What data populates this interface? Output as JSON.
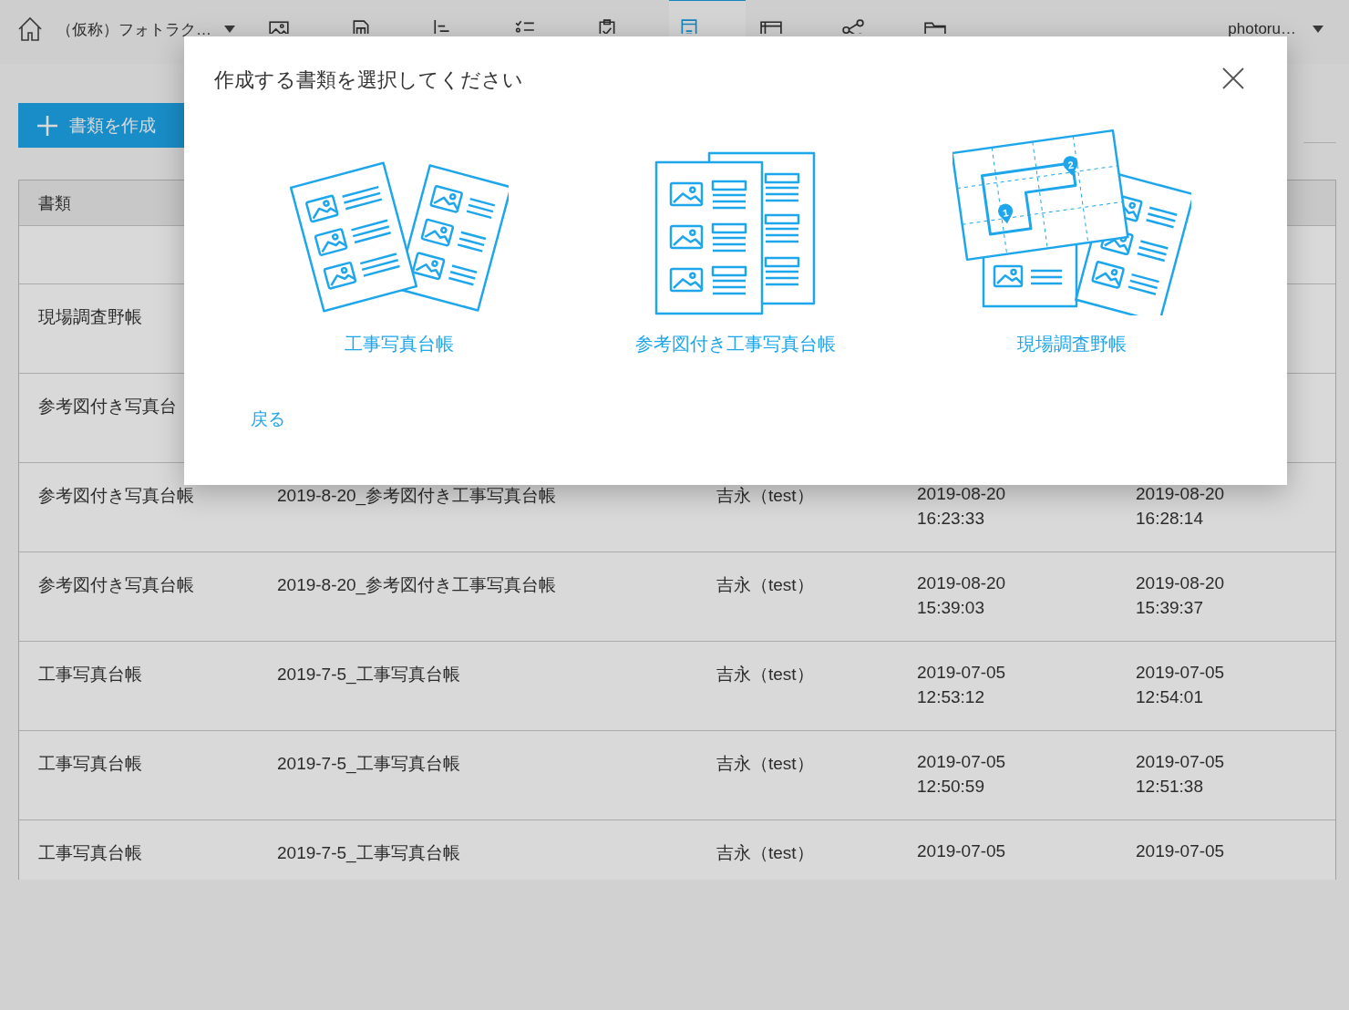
{
  "nav": {
    "project": {
      "label": "（仮称）フォトラク…"
    },
    "items": [
      {
        "kind": "photo",
        "selected": false
      },
      {
        "kind": "drawing",
        "selected": false
      },
      {
        "kind": "schedule",
        "selected": false
      },
      {
        "kind": "task",
        "selected": false
      },
      {
        "kind": "inspection",
        "selected": false
      },
      {
        "kind": "document",
        "selected": true
      },
      {
        "kind": "board",
        "selected": false
      },
      {
        "kind": "share",
        "selected": false
      },
      {
        "kind": "folder",
        "selected": false
      }
    ],
    "user": {
      "label": "photoru…"
    }
  },
  "create_button": {
    "label": "書類を作成"
  },
  "table": {
    "columns": [
      {
        "label": "書類"
      }
    ],
    "rows": [
      {
        "type": "現場調査野帳"
      },
      {
        "type": "参考図付き写真台"
      },
      {
        "type": "参考図付き写真台帳",
        "name": "2019-8-20_参考図付き工事写真台帳",
        "user": "吉永（test）",
        "created": {
          "date": "2019-08-20",
          "time": "16:23:33"
        },
        "updated": {
          "date": "2019-08-20",
          "time": "16:28:14"
        }
      },
      {
        "type": "参考図付き写真台帳",
        "name": "2019-8-20_参考図付き工事写真台帳",
        "user": "吉永（test）",
        "created": {
          "date": "2019-08-20",
          "time": "15:39:03"
        },
        "updated": {
          "date": "2019-08-20",
          "time": "15:39:37"
        }
      },
      {
        "type": "工事写真台帳",
        "name": "2019-7-5_工事写真台帳",
        "user": "吉永（test）",
        "created": {
          "date": "2019-07-05",
          "time": "12:53:12"
        },
        "updated": {
          "date": "2019-07-05",
          "time": "12:54:01"
        }
      },
      {
        "type": "工事写真台帳",
        "name": "2019-7-5_工事写真台帳",
        "user": "吉永（test）",
        "created": {
          "date": "2019-07-05",
          "time": "12:50:59"
        },
        "updated": {
          "date": "2019-07-05",
          "time": "12:51:38"
        }
      },
      {
        "type": "工事写真台帳",
        "name": "2019-7-5_工事写真台帳",
        "user": "吉永（test）",
        "created": {
          "date": "2019-07-05"
        },
        "updated": {
          "date": "2019-07-05"
        }
      }
    ]
  },
  "dialog": {
    "title": "作成する書類を選択してください",
    "options": [
      {
        "kind": "photo-ledger",
        "label": "工事写真台帳"
      },
      {
        "kind": "reference-ledger",
        "label": "参考図付き工事写真台帳"
      },
      {
        "kind": "survey-notebook",
        "label": "現場調査野帳",
        "pins": [
          "1",
          "2"
        ]
      }
    ],
    "back_link": "戻る"
  }
}
